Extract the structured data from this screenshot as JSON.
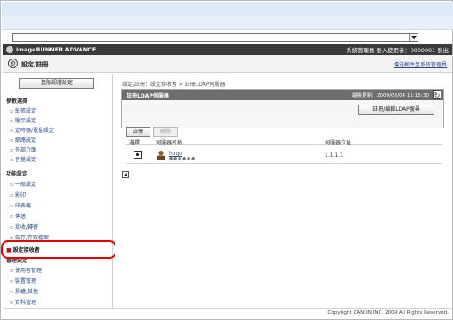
{
  "app": {
    "brand": "imageRUNNER ADVANCE",
    "user_info": "系統管理員 登入使用者：0000001 登出",
    "page_title": "設定/註冊",
    "to_admin_link": "傳送郵件至系統管理員"
  },
  "sidebar": {
    "top_button": "進階認證設定",
    "sections": [
      {
        "label": "參數選擇"
      },
      {
        "label": "功能設定"
      },
      {
        "label": "管理設定"
      }
    ],
    "items": [
      "紙張設定",
      "顯示設定",
      "定時器/電量設定",
      "網路設定",
      "外部介面",
      "音量設定",
      "一般設定",
      "影印",
      "印表機",
      "傳送",
      "接收/轉寄",
      "儲存/存取檔案",
      "設定接收者",
      "使用者管理",
      "裝置管理",
      "授權/其他",
      "資料管理"
    ],
    "active_item": "設定接收者"
  },
  "main": {
    "breadcrumb": "設定/註冊：設定接收者 > 註冊LDAP伺服器",
    "panel_title": "註冊LDAP伺服器",
    "last_update": "最後更新：2009/08/04 11:15:30",
    "register_edit_button": "註冊/編輯LDAP搜尋",
    "register_button": "註冊",
    "delete_button": "刪除",
    "columns": [
      "選擇",
      "伺服器名稱",
      "伺服器位址"
    ],
    "rows": [
      {
        "name": "hogo",
        "sub": "●●●●●●",
        "address": "1.1.1.1"
      }
    ],
    "top_icon": "top-icon"
  },
  "footer": {
    "copyright": "Copyright CANON INC. 2009 All Rights Reserved."
  },
  "colors": {
    "highlight": "#e10000",
    "appbar": "#3a3a3a",
    "link": "#2a4a8a"
  }
}
